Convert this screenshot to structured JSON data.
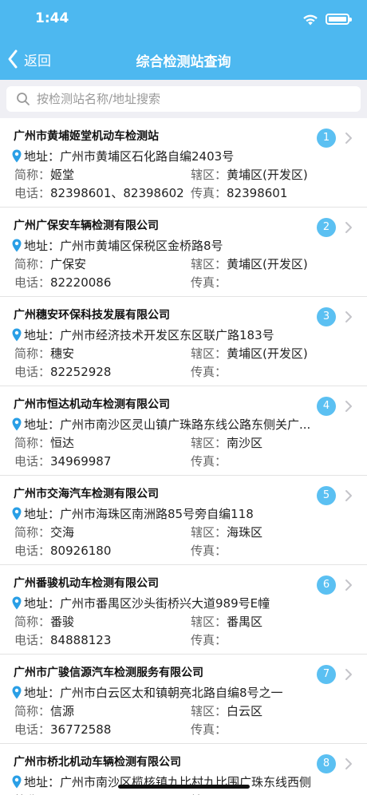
{
  "status": {
    "time": "1:44"
  },
  "nav": {
    "back_label": "返回",
    "title": "综合检测站查询"
  },
  "search": {
    "placeholder": "按检测站名称/地址搜索",
    "value": ""
  },
  "labels": {
    "address": "地址：",
    "short_name": "简称：",
    "district": "辖区：",
    "phone": "电话：",
    "fax": "传真："
  },
  "stations": [
    {
      "index": "1",
      "name": "广州市黄埔姬堂机动车检测站",
      "address": "广州市黄埔区石化路自编2403号",
      "short_name": "姬堂",
      "district": "黄埔区(开发区)",
      "phone": "82398601、82398602",
      "fax": "82398601"
    },
    {
      "index": "2",
      "name": "广州广保安车辆检测有限公司",
      "address": "广州市黄埔区保税区金桥路8号",
      "short_name": "广保安",
      "district": "黄埔区(开发区)",
      "phone": "82220086",
      "fax": ""
    },
    {
      "index": "3",
      "name": "广州穗安环保科技发展有限公司",
      "address": "广州市经济技术开发区东区联广路183号",
      "short_name": "穗安",
      "district": "黄埔区(开发区)",
      "phone": "82252928",
      "fax": ""
    },
    {
      "index": "4",
      "name": "广州市恒达机动车检测有限公司",
      "address": "广州市南沙区灵山镇广珠路东线公路东侧关广...",
      "short_name": "恒达",
      "district": "南沙区",
      "phone": "34969987",
      "fax": ""
    },
    {
      "index": "5",
      "name": "广州市交海汽车检测有限公司",
      "address": "广州市海珠区南洲路85号旁自编118",
      "short_name": "交海",
      "district": "海珠区",
      "phone": "80926180",
      "fax": ""
    },
    {
      "index": "6",
      "name": "广州番骏机动车检测有限公司",
      "address": "广州市番禺区沙头街桥兴大道989号E幢",
      "short_name": "番骏",
      "district": "番禺区",
      "phone": "84888123",
      "fax": ""
    },
    {
      "index": "7",
      "name": "广州市广骏信源汽车检测服务有限公司",
      "address": "广州市白云区太和镇朝亮北路自编8号之一",
      "short_name": "信源",
      "district": "白云区",
      "phone": "36772588",
      "fax": ""
    },
    {
      "index": "8",
      "name": "广州市桥北机动车辆检测有限公司",
      "address": "广州市南沙区榄核镇九比村九比围广珠东线西侧",
      "short_name": "",
      "district": "",
      "phone": "",
      "fax": ""
    }
  ],
  "colors": {
    "accent": "#4db8f0",
    "badge": "#5bc0f2",
    "pin": "#2a9fe6"
  }
}
